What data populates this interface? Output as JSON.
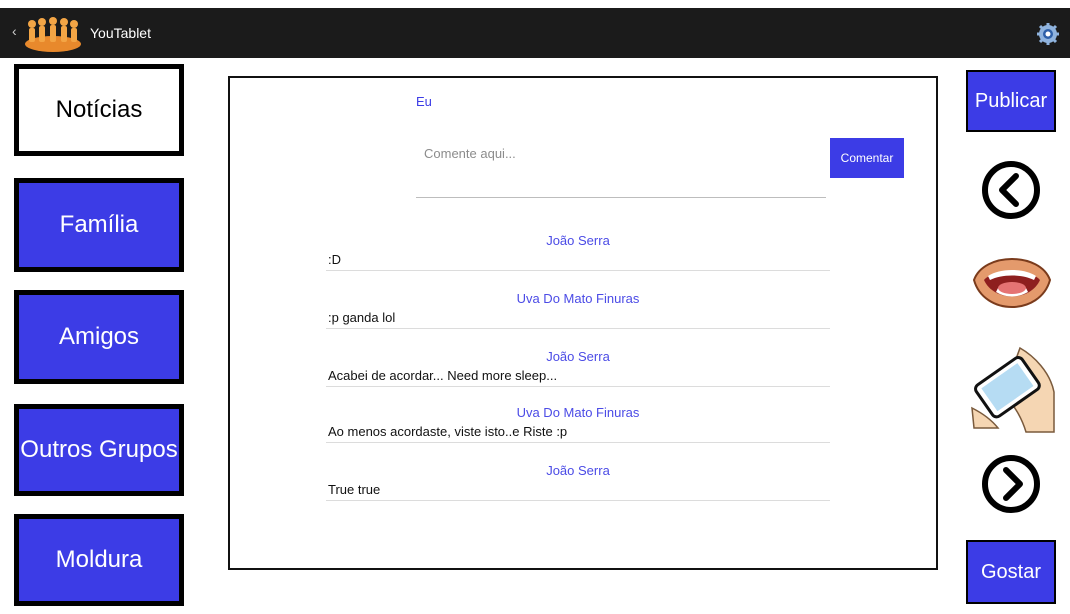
{
  "app": {
    "title": "YouTablet"
  },
  "nav": {
    "items": [
      {
        "label": "Notícias"
      },
      {
        "label": "Família"
      },
      {
        "label": "Amigos"
      },
      {
        "label": "Outros Grupos"
      },
      {
        "label": "Moldura"
      }
    ]
  },
  "composer": {
    "user": "Eu",
    "placeholder": "Comente aqui...",
    "button_label": "Comentar"
  },
  "posts": [
    {
      "author": "João Serra",
      "text": ":D"
    },
    {
      "author": "Uva Do Mato Finuras",
      "text": ":p ganda lol"
    },
    {
      "author": "João Serra",
      "text": "Acabei de acordar... Need more sleep..."
    },
    {
      "author": "Uva Do Mato Finuras",
      "text": "Ao menos acordaste,  viste isto..e Riste :p"
    },
    {
      "author": "João Serra",
      "text": "True true"
    }
  ],
  "right": {
    "publish_label": "Publicar",
    "like_label": "Gostar"
  },
  "colors": {
    "accent": "#3c3ce6",
    "topbar": "#1b1b1b"
  }
}
